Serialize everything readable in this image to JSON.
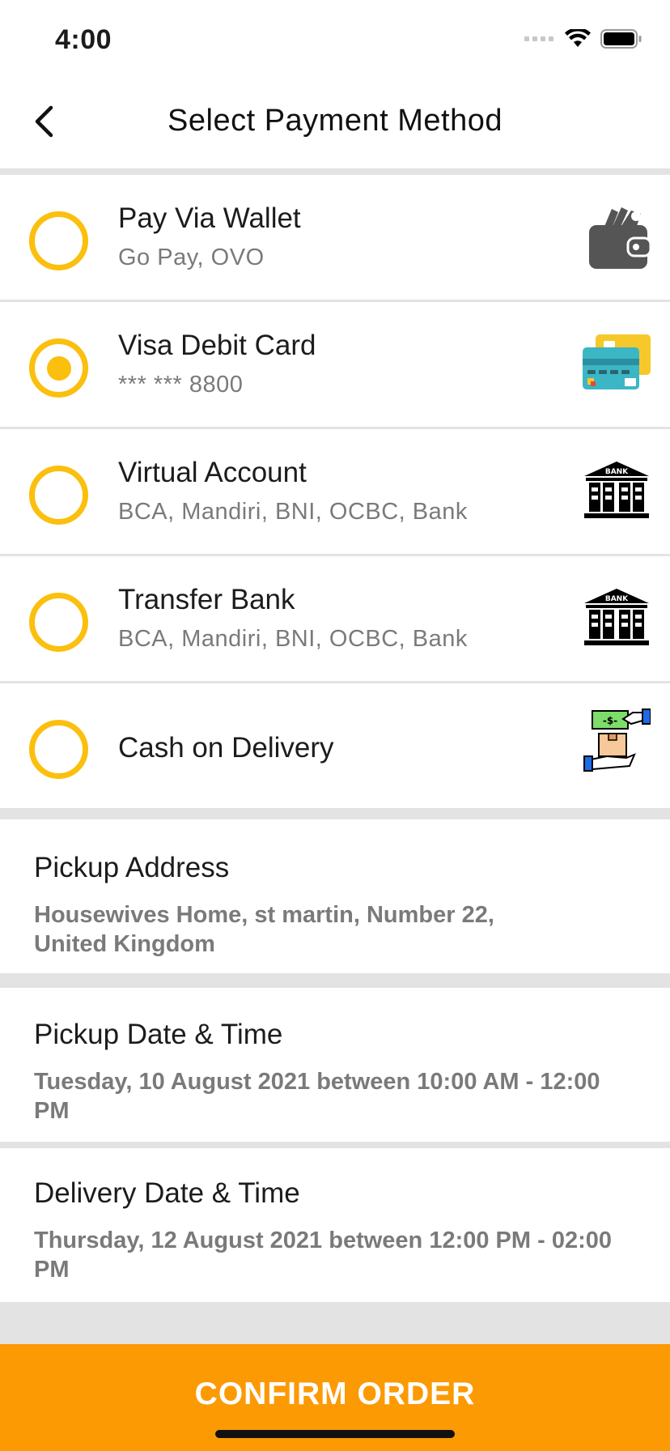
{
  "status_bar": {
    "time": "4:00"
  },
  "nav": {
    "title": "Select Payment Method"
  },
  "payment_methods": [
    {
      "title": "Pay Via Wallet",
      "subtitle": "Go Pay, OVO",
      "icon": "wallet-icon",
      "selected": false
    },
    {
      "title": "Visa Debit Card",
      "subtitle": "*** *** 8800",
      "icon": "credit-card-icon",
      "selected": true
    },
    {
      "title": "Virtual Account",
      "subtitle": "BCA, Mandiri, BNI, OCBC, Bank",
      "icon": "bank-icon",
      "icon_text": "BANK",
      "selected": false
    },
    {
      "title": "Transfer Bank",
      "subtitle": "BCA, Mandiri, BNI, OCBC, Bank",
      "icon": "bank-icon",
      "icon_text": "BANK",
      "selected": false
    },
    {
      "title": "Cash on Delivery",
      "subtitle": "",
      "icon": "cash-delivery-icon",
      "selected": false
    }
  ],
  "pickup_address": {
    "title": "Pickup Address",
    "value": "Housewives Home, st martin, Number 22, United Kingdom"
  },
  "pickup_datetime": {
    "title": "Pickup Date & Time",
    "value": "Tuesday, 10 August 2021 between 10:00 AM - 12:00 PM"
  },
  "delivery_datetime": {
    "title": "Delivery Date & Time",
    "value": "Thursday, 12 August 2021 between 12:00 PM - 02:00 PM"
  },
  "confirm": {
    "label": "CONFIRM ORDER"
  },
  "colors": {
    "accent": "#fbbf0e",
    "button": "#fc9a04",
    "divider": "#e3e3e3",
    "subtext": "#7a7a7a"
  }
}
